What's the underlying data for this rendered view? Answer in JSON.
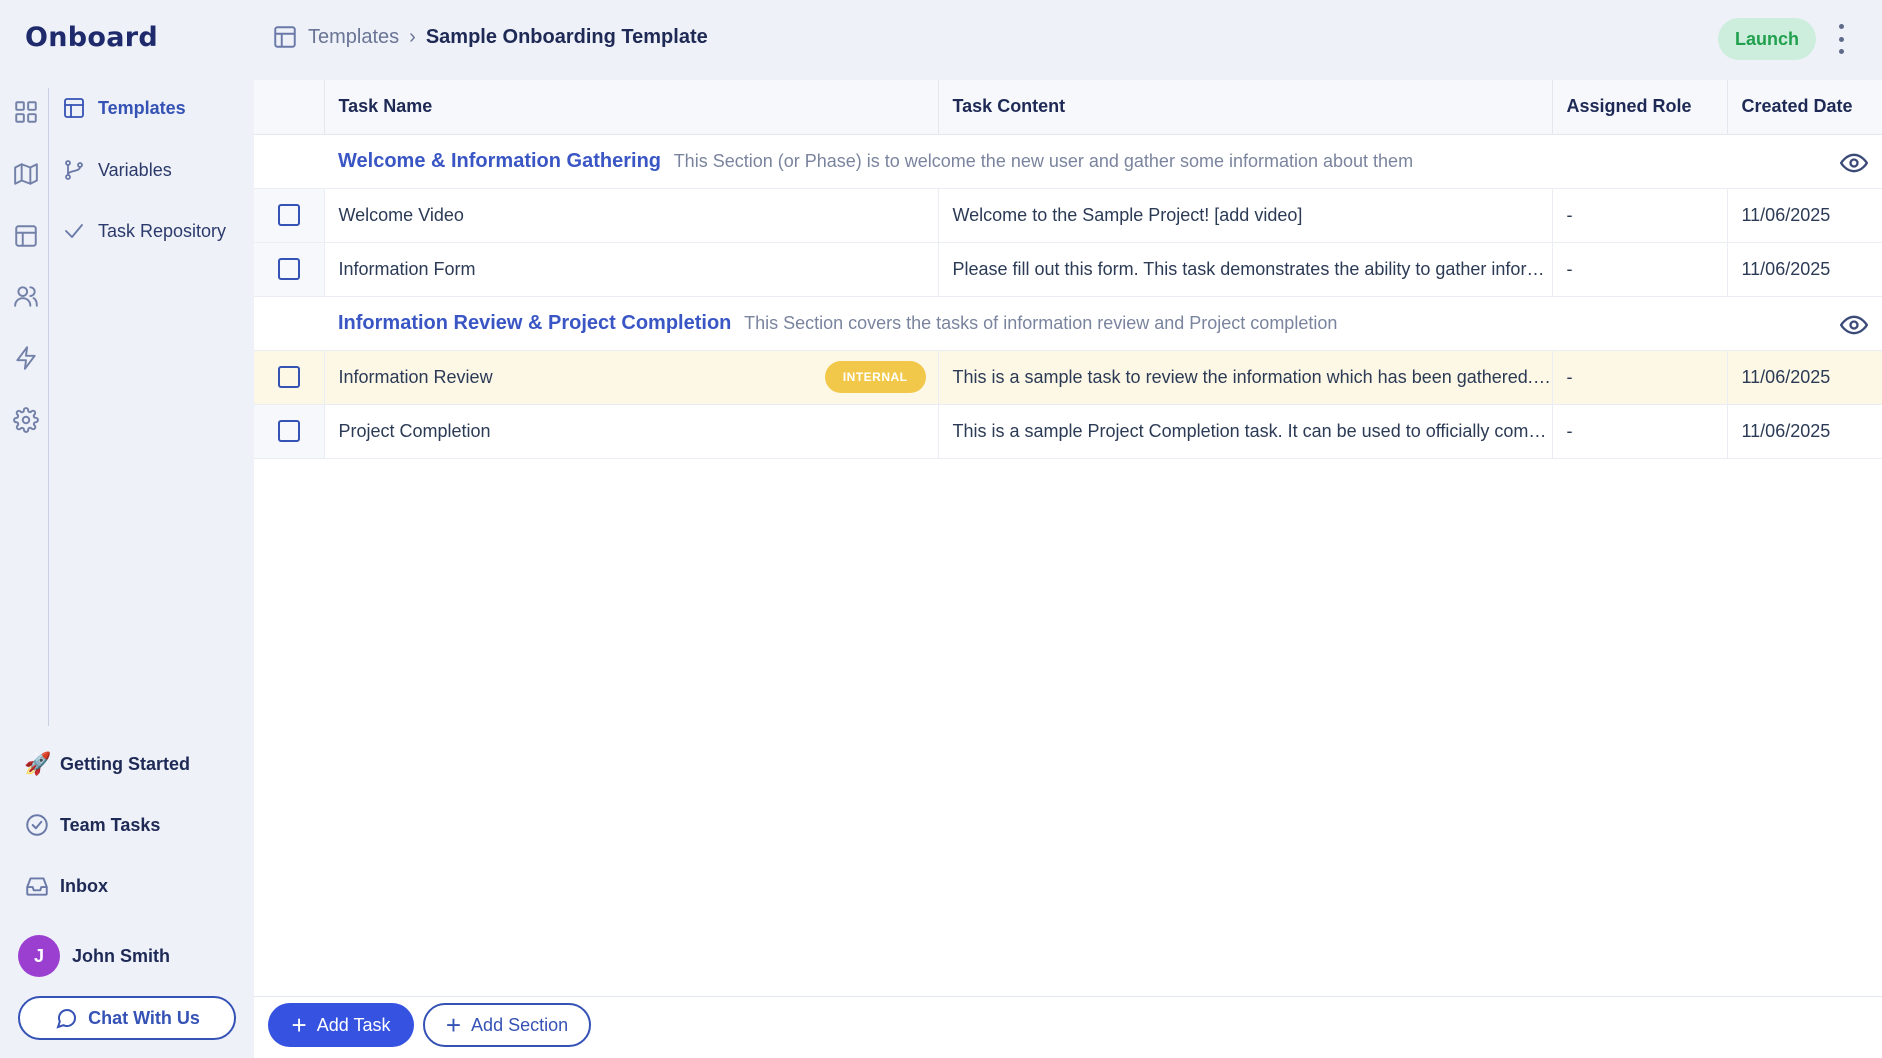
{
  "app": {
    "logo": "Onboard"
  },
  "subnav": [
    {
      "label": "Templates",
      "icon": "template-icon",
      "active": true
    },
    {
      "label": "Variables",
      "icon": "branch-icon"
    },
    {
      "label": "Task Repository",
      "icon": "check-icon"
    }
  ],
  "bottom_nav": {
    "getting_started": "Getting Started",
    "team_tasks": "Team Tasks",
    "inbox": "Inbox"
  },
  "user": {
    "initial": "J",
    "name": "John Smith"
  },
  "chat_button": "Chat With Us",
  "breadcrumb": {
    "parent": "Templates",
    "separator": "›",
    "current": "Sample Onboarding Template"
  },
  "header": {
    "launch": "Launch"
  },
  "table": {
    "columns": [
      "Task Name",
      "Task Content",
      "Assigned Role",
      "Created Date"
    ],
    "sections": [
      {
        "title": "Welcome & Information Gathering",
        "description": "This Section (or Phase) is to welcome the new user and gather some information about them",
        "tasks": [
          {
            "name": "Welcome Video",
            "content": "Welcome to the Sample Project! [add video]",
            "role": "-",
            "date": "11/06/2025"
          },
          {
            "name": "Information Form",
            "content": "Please fill out this form. This task demonstrates the ability to gather information from users",
            "role": "-",
            "date": "11/06/2025"
          }
        ]
      },
      {
        "title": "Information Review & Project Completion",
        "description": "This Section covers the tasks of information review and Project completion",
        "tasks": [
          {
            "name": "Information Review",
            "badge": "INTERNAL",
            "content": "This is a sample task to review the information which has been gathered. It is internal",
            "role": "-",
            "date": "11/06/2025"
          },
          {
            "name": "Project Completion",
            "content": "This is a sample Project Completion task. It can be used to officially complete the project",
            "role": "-",
            "date": "11/06/2025"
          }
        ]
      }
    ]
  },
  "footer": {
    "add_task": "Add Task",
    "add_section": "Add Section"
  },
  "colors": {
    "accent": "#3552e0",
    "launch_bg": "#cdeedc",
    "launch_text": "#21a04e",
    "badge": "#f2c84b",
    "avatar": "#9b3fd0"
  }
}
